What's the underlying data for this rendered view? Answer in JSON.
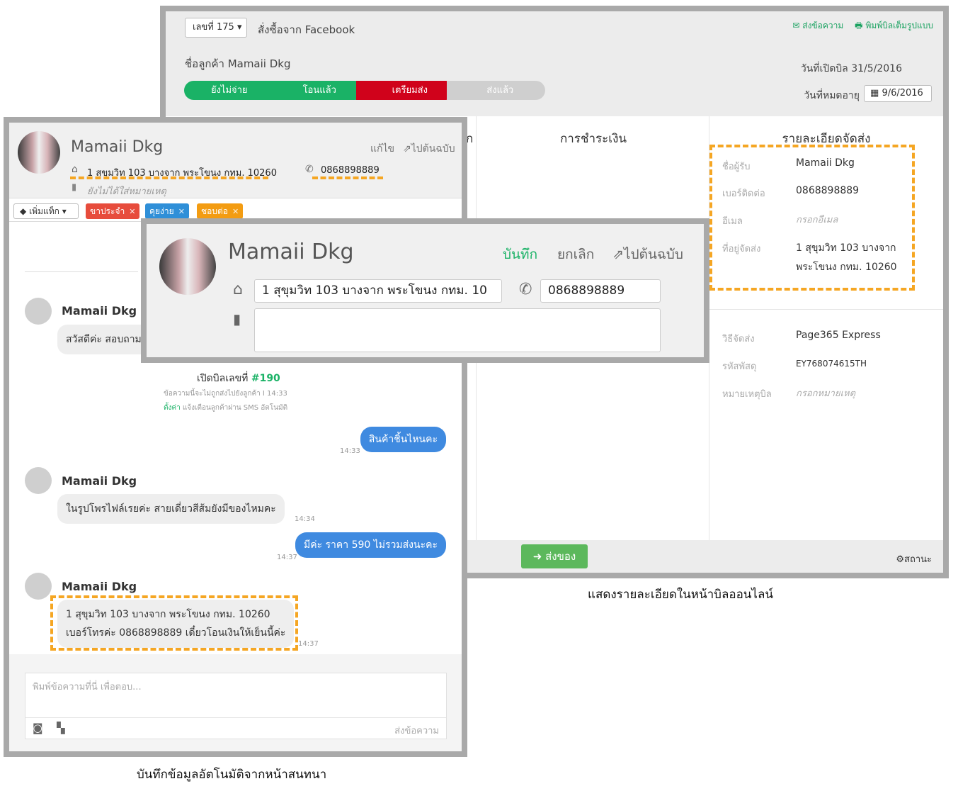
{
  "bill": {
    "bill_number": "เลขที่ 175",
    "order_source": "สั่งซื้อจาก Facebook",
    "send_message": "ส่งข้อความ",
    "print_full": "พิมพ์บิลเต็มรูปแบบ",
    "customer_name": "ชื่อลูกค้า Mamaii Dkg",
    "open_date": "วันที่เปิดบิล 31/5/2016",
    "expire_label": "วันที่หมดอายุ",
    "expire_value": "9/6/2016",
    "status_steps": [
      "ยังไม่จ่าย",
      "โอนแล้ว",
      "เตรียมส่ง",
      "ส่งแล้ว"
    ],
    "payment_header": "การชำระเงิน",
    "shipping_header": "รายละเอียดจัดส่ง",
    "shipping": {
      "recipient_label": "ชื่อผู้รับ",
      "recipient_value": "Mamaii Dkg",
      "phone_label": "เบอร์ติดต่อ",
      "phone_value": "0868898889",
      "email_label": "อีเมล",
      "email_placeholder": "กรอกอีเมล",
      "address_label": "ที่อยู่จัดส่ง",
      "address_line1": "1 สุขุมวิท 103 บางจาก",
      "address_line2": "พระโขนง กทม. 10260",
      "method_label": "วิธีจัดส่ง",
      "method_value": "Page365 Express",
      "tracking_label": "รหัสพัสดุ",
      "tracking_value": "EY768074615TH",
      "note_label": "หมายเหตุบิล",
      "note_placeholder": "กรอกหมายเหตุ"
    },
    "ship_button": "ส่งของ",
    "status_link": "สถานะ",
    "stray_text": "ก"
  },
  "caption_bill": "แสดงรายละเอียดในหน้าบิลออนไลน์",
  "chat": {
    "name": "Mamaii Dkg",
    "edit": "แก้ไข",
    "go_original": "ไปต้นฉบับ",
    "address": "1 สุขุมวิท 103 บางจาก พระโขนง กทม. 10260",
    "phone": "0868898889",
    "no_note": "ยังไม่ได้ใส่หมายเหตุ",
    "add_tag": "เพิ่มแท็ก",
    "tags": [
      {
        "label": "ขาประจำ",
        "color": "#e74c3c"
      },
      {
        "label": "คุยง่าย",
        "color": "#2f8fd8"
      },
      {
        "label": "ชอบต่อ",
        "color": "#f39c12"
      }
    ],
    "messages": {
      "m1_name": "Mamaii Dkg",
      "m1_text": "สวัสดีค่ะ สอบถาม",
      "bill_open_prefix": "เปิดบิลเลขที่ ",
      "bill_open_number": "#190",
      "bill_notice": "ข้อความนี้จะไม่ถูกส่งไปยังลูกค้า I 14:33",
      "sms_link": "ตั้งค่า",
      "sms_text": " แจ้งเตือนลูกค้าผ่าน SMS อัตโนมัติ",
      "my1": "สินค้าชิ้นไหนคะ",
      "my1_time": "14:33",
      "m2_name": "Mamaii Dkg",
      "m2_text": "ในรูปโพรไฟล์เรยค่ะ สายเดี่ยวสีส้มยังมีของไหมคะ",
      "m2_time": "14:34",
      "my2": "มีค่ะ ราคา 590 ไม่รวมส่งนะคะ",
      "my2_time": "14:37",
      "m3_name": "Mamaii Dkg",
      "m3_line1": "1 สุขุมวิท 103 บางจาก พระโขนง กทม. 10260",
      "m3_line2": "เบอร์โทรค่ะ 0868898889 เดี๋ยวโอนเงินให้เย็นนี้ค่ะ",
      "m3_time": "14:37"
    },
    "reply_placeholder": "พิมพ์ข้อความที่นี่ เพื่อตอบ...",
    "send_label": "ส่งข้อความ"
  },
  "caption_chat": "บันทึกข้อมูลอัตโนมัติจากหน้าสนทนา",
  "edit": {
    "name": "Mamaii Dkg",
    "save": "บันทึก",
    "cancel": "ยกเลิก",
    "go_original": "ไปต้นฉบับ",
    "address_value": "1 สุขุมวิท 103 บางจาก พระโขนง กทม. 10",
    "phone_value": "0868898889",
    "note_value": ""
  },
  "colors": {
    "green": "#1ab266",
    "red": "#d0021b",
    "blue": "#3f8ae0",
    "highlight": "#f5a623"
  }
}
